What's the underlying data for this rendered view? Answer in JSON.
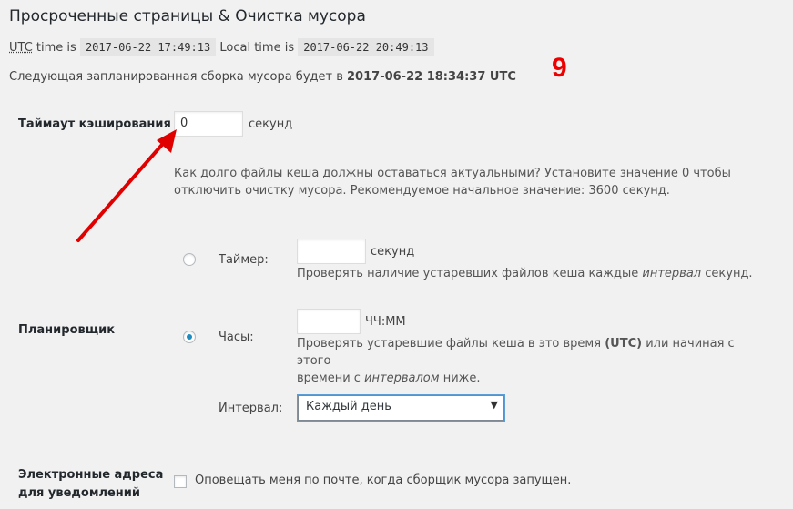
{
  "title": "Просроченные страницы & Очистка мусора",
  "time": {
    "utc_abbr": "UTC",
    "utc_label": " time is",
    "utc_value": "2017-06-22 17:49:13",
    "local_label": "Local time is",
    "local_value": "2017-06-22 20:49:13"
  },
  "schedule_note": {
    "prefix": "Следующая запланированная сборка мусора будет в",
    "datetime": "2017-06-22 18:34:37 UTC"
  },
  "annotation": {
    "step_number": "9",
    "color": "#e00000",
    "arrow_icon": "red-arrow"
  },
  "cache_timeout": {
    "label": "Таймаут кэширования",
    "value": "0",
    "unit": "секунд",
    "description": "Как долго файлы кеша должны оставаться актуальными? Установите значение 0 чтобы отключить очистку мусора. Рекомендуемое начальное значение: 3600 секунд."
  },
  "scheduler": {
    "label": "Планировщик",
    "timer": {
      "label": "Таймер:",
      "value": "",
      "unit": "секунд",
      "selected": false,
      "desc_prefix": "Проверять наличие устаревших файлов кеша каждые",
      "desc_em": "интервал",
      "desc_suffix": "секунд."
    },
    "clock": {
      "label": "Часы:",
      "value": "",
      "unit": "ЧЧ:ММ",
      "selected": true,
      "desc_a": "Проверять устаревшие файлы кеша в это время",
      "desc_strong": "(UTC)",
      "desc_b": "или начиная с этого",
      "desc_c": "времени с",
      "desc_em": "интервалом",
      "desc_d": "ниже."
    },
    "interval": {
      "label": "Интервал:",
      "selected": "Каждый день"
    }
  },
  "notify": {
    "label_line1": "Электронные адреса",
    "label_line2": "для уведомлений",
    "checkbox_label": "Оповещать меня по почте, когда сборщик мусора запущен.",
    "checked": false
  }
}
